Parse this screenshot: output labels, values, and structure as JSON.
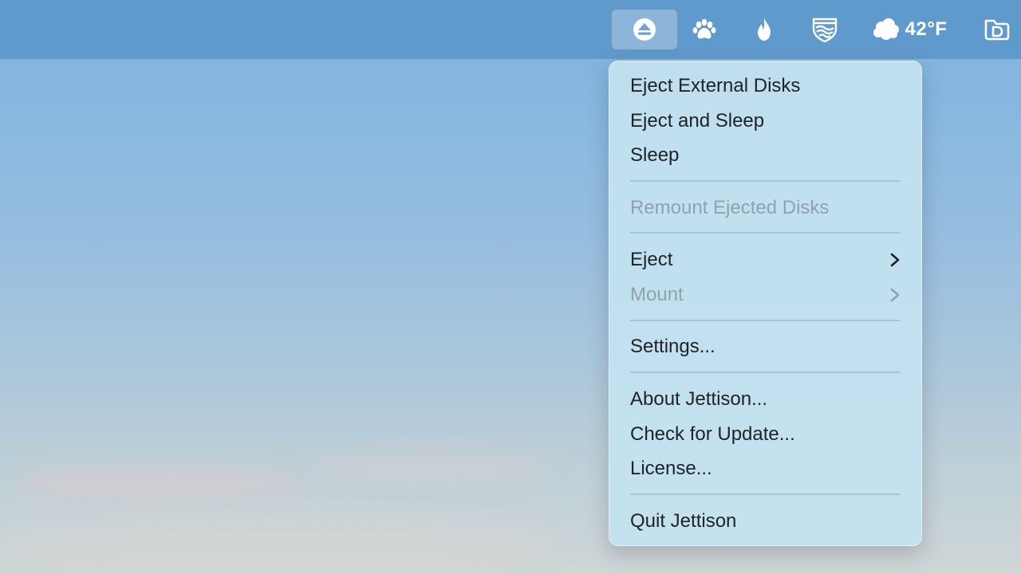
{
  "menubar": {
    "items": [
      {
        "icon": "eject-icon",
        "active": true
      },
      {
        "icon": "paw-icon"
      },
      {
        "icon": "flame-icon"
      },
      {
        "icon": "shield-wave-icon"
      },
      {
        "icon": "cloud-icon",
        "label": "42°F"
      },
      {
        "icon": "folder-d-icon"
      }
    ]
  },
  "menu": {
    "items": [
      {
        "label": "Eject External Disks",
        "enabled": true
      },
      {
        "label": "Eject and Sleep",
        "enabled": true
      },
      {
        "label": "Sleep",
        "enabled": true
      },
      {
        "label": "Remount Ejected Disks",
        "enabled": false
      },
      {
        "label": "Eject",
        "enabled": true,
        "submenu": true
      },
      {
        "label": "Mount",
        "enabled": false,
        "submenu": true
      },
      {
        "label": "Settings...",
        "enabled": true
      },
      {
        "label": "About Jettison...",
        "enabled": true
      },
      {
        "label": "Check for Update...",
        "enabled": true
      },
      {
        "label": "License...",
        "enabled": true
      },
      {
        "label": "Quit Jettison",
        "enabled": true
      }
    ]
  },
  "colors": {
    "menubar": "#5a94c8",
    "menu_bg": "#c4e2f0",
    "text": "#1d2326",
    "disabled_text": "#8fa2ad"
  }
}
